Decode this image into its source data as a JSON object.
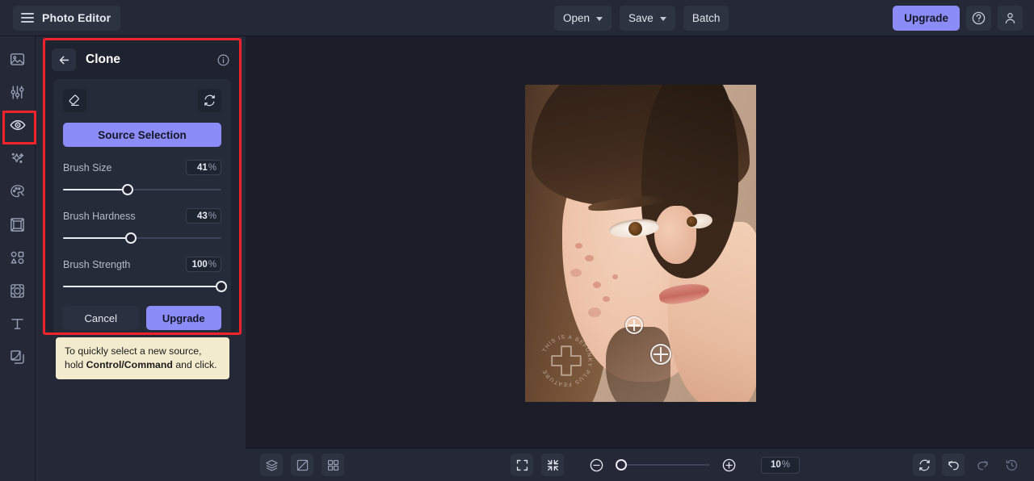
{
  "app": {
    "title": "Photo Editor",
    "accent": "#8b8cf7",
    "annotation_color": "#f0222a",
    "panel_bg": "#1f2330",
    "chrome_bg": "#252937",
    "canvas_bg": "#1b1e29"
  },
  "topbar": {
    "menu_icon": "hamburger-icon",
    "open_label": "Open",
    "save_label": "Save",
    "batch_label": "Batch",
    "upgrade_label": "Upgrade",
    "help_icon": "question-circle-icon",
    "account_icon": "user-icon"
  },
  "sidebar": {
    "items": [
      {
        "name": "sidebar-item-image",
        "icon": "image-icon",
        "selected": false
      },
      {
        "name": "sidebar-item-edit",
        "icon": "sliders-icon",
        "selected": false
      },
      {
        "name": "sidebar-item-retouch",
        "icon": "eye-icon",
        "selected": true
      },
      {
        "name": "sidebar-item-effects",
        "icon": "sparkles-icon",
        "selected": false
      },
      {
        "name": "sidebar-item-artsy",
        "icon": "palette-icon",
        "selected": false
      },
      {
        "name": "sidebar-item-frames",
        "icon": "frame-icon",
        "selected": false
      },
      {
        "name": "sidebar-item-graphics",
        "icon": "shapes-icon",
        "selected": false
      },
      {
        "name": "sidebar-item-textures",
        "icon": "texture-icon",
        "selected": false
      },
      {
        "name": "sidebar-item-text",
        "icon": "text-t-icon",
        "selected": false
      },
      {
        "name": "sidebar-item-layers",
        "icon": "layers-icon",
        "selected": false
      }
    ]
  },
  "panel": {
    "back_icon": "arrow-left-icon",
    "title": "Clone",
    "info_icon": "info-circle-icon",
    "eraser_icon": "eraser-icon",
    "reset_icon": "refresh-icon",
    "source_selection_label": "Source Selection",
    "sliders": [
      {
        "label": "Brush Size",
        "value": "41",
        "unit": "%",
        "percent": 41
      },
      {
        "label": "Brush Hardness",
        "value": "43",
        "unit": "%",
        "percent": 43
      },
      {
        "label": "Brush Strength",
        "value": "100",
        "unit": "%",
        "percent": 100
      }
    ],
    "cancel_label": "Cancel",
    "upgrade_label": "Upgrade"
  },
  "tooltip": {
    "text_before": "To quickly select a new source, hold ",
    "text_bold": "Control/Command",
    "text_after": " and click."
  },
  "canvas": {
    "watermark_text": "THIS IS A BEFUNKY PLUS FEATURE",
    "source_marker_icon": "clone-source-crosshair-icon",
    "brush_cursor_icon": "clone-brush-crosshair-icon"
  },
  "bottombar": {
    "layers_icon": "layers-stack-icon",
    "compare_icon": "compare-icon",
    "grid_icon": "grid-icon",
    "fullscreen_icon": "expand-icon",
    "fit_icon": "collapse-icon",
    "zoom_out_icon": "minus-circle-icon",
    "zoom_in_icon": "plus-circle-icon",
    "zoom_value": "10",
    "zoom_unit": "%",
    "zoom_percent": 0,
    "reset_icon": "refresh-icon",
    "undo_icon": "undo-icon",
    "redo_icon": "redo-icon",
    "history_icon": "history-icon"
  }
}
